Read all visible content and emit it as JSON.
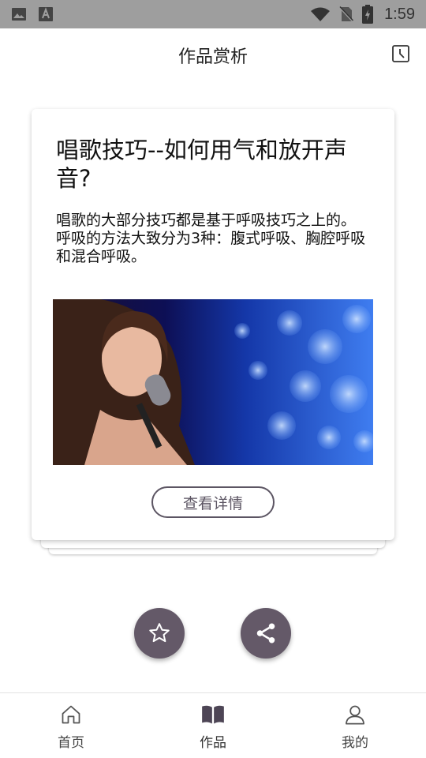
{
  "status_bar": {
    "time": "1:59",
    "icons": [
      "image-icon",
      "text-a-icon",
      "wifi-icon",
      "no-sim-icon",
      "battery-icon"
    ]
  },
  "header": {
    "title": "作品赏析",
    "action_icon": "history-icon"
  },
  "card": {
    "title": "唱歌技巧--如何用气和放开声音?",
    "body_lines": [
      "唱歌的大部分技巧都是基于呼吸技巧之上的。",
      "呼吸的方法大致分为3种：腹式呼吸、胸腔呼吸和混合呼吸。"
    ],
    "detail_button_label": "查看详情"
  },
  "fabs": {
    "favorite_icon": "star-icon",
    "share_icon": "share-icon"
  },
  "bottom_nav": {
    "items": [
      {
        "label": "首页",
        "icon": "home-icon"
      },
      {
        "label": "作品",
        "icon": "book-icon",
        "active": true
      },
      {
        "label": "我的",
        "icon": "user-icon"
      }
    ]
  },
  "colors": {
    "status_bar_bg": "#9e9e9e",
    "accent": "#645968",
    "button_border": "#5c5563"
  }
}
